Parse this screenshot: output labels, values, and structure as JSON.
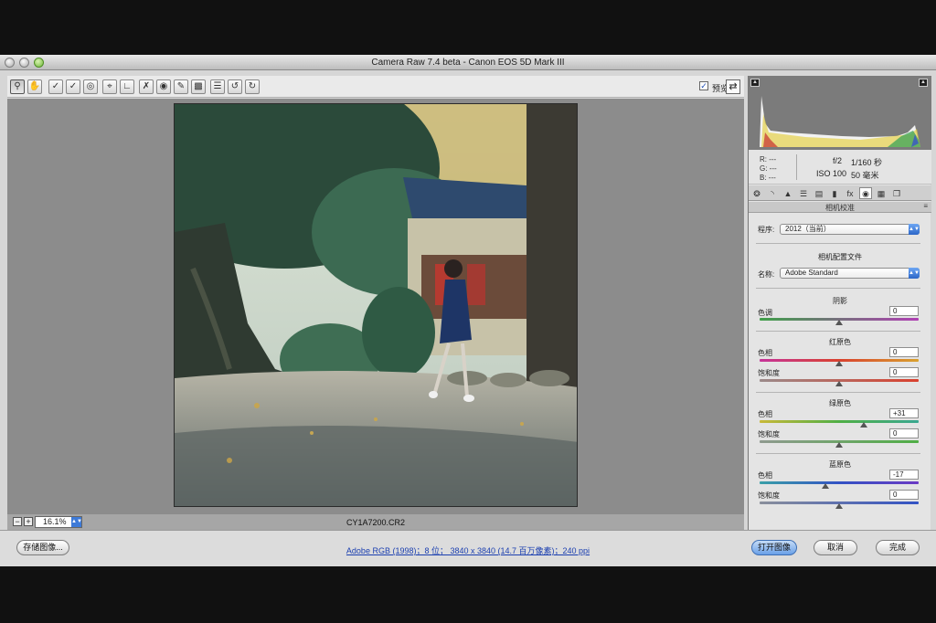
{
  "window": {
    "title": "Camera Raw 7.4 beta -  Canon EOS 5D Mark III"
  },
  "toolbar": {
    "tools": [
      "zoom-tool",
      "hand-tool",
      "white-balance-tool",
      "color-sampler-tool",
      "target-adjustment-tool",
      "crop-tool",
      "straighten-tool",
      "spot-removal-tool",
      "red-eye-tool",
      "adjustment-brush-tool",
      "graduated-filter-tool",
      "radial-filter-tool",
      "preferences",
      "rotate-ccw",
      "rotate-cw"
    ],
    "preview_label": "预览",
    "preview_checked": true
  },
  "status": {
    "zoom": "16.1%",
    "zoom_out": "−",
    "zoom_in": "+",
    "filename": "CY1A7200.CR2"
  },
  "readout": {
    "r": "R:  ---",
    "g": "G:  ---",
    "b": "B:  ---",
    "aperture": "f/2",
    "shutter": "1/160 秒",
    "iso": "ISO 100",
    "focal": "50 毫米"
  },
  "panel": {
    "title": "相机校准",
    "process_label": "程序:",
    "process_value": "2012（当前）",
    "profile_section": "相机配置文件",
    "name_label": "名称:",
    "name_value": "Adobe Standard",
    "shadows": {
      "title": "阴影",
      "tint_label": "色调",
      "tint_value": "0"
    },
    "red": {
      "title": "红原色",
      "hue_label": "色相",
      "hue_value": "0",
      "sat_label": "饱和度",
      "sat_value": "0"
    },
    "green": {
      "title": "绿原色",
      "hue_label": "色相",
      "hue_value": "+31",
      "sat_label": "饱和度",
      "sat_value": "0"
    },
    "blue": {
      "title": "蓝原色",
      "hue_label": "色相",
      "hue_value": "-17",
      "sat_label": "饱和度",
      "sat_value": "0"
    }
  },
  "sliders": {
    "shadows_tint": 0,
    "red_hue": 0,
    "red_sat": 0,
    "green_hue": 31,
    "green_sat": 0,
    "blue_hue": -17,
    "blue_sat": 0
  },
  "bottom": {
    "save_label": "存储图像...",
    "info_link": "Adobe RGB (1998)；8 位；  3840 x 3840 (14.7 百万像素)；240 ppi",
    "open_label": "打开图像",
    "cancel_label": "取消",
    "done_label": "完成"
  }
}
